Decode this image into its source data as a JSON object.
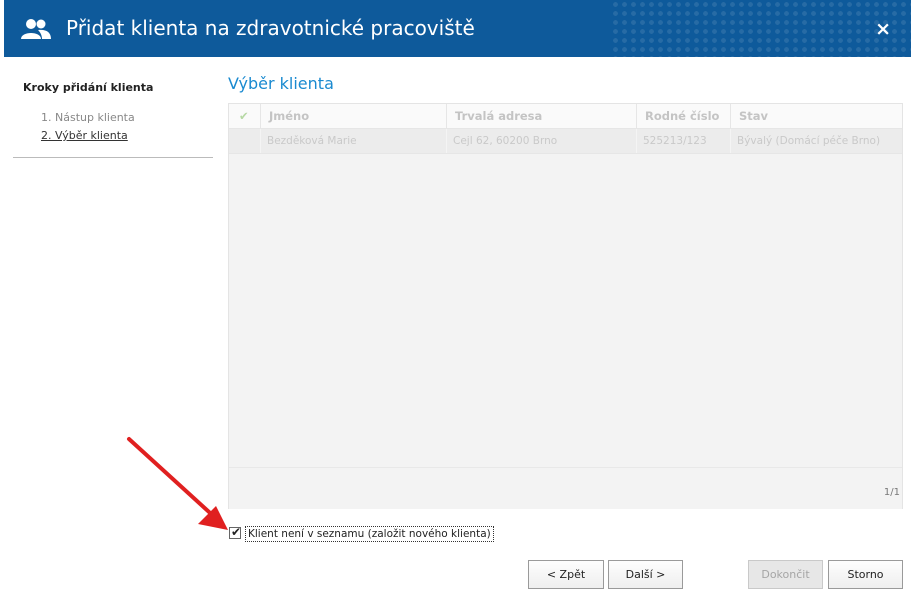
{
  "dialog": {
    "title": "Přidat klienta na zdravotnické pracoviště",
    "close_label": "×"
  },
  "steps": {
    "title": "Kroky přidání klienta",
    "items": [
      {
        "label": "1. Nástup klienta",
        "active": false
      },
      {
        "label": "2. Výběr klienta",
        "active": true
      }
    ]
  },
  "main": {
    "section_title": "Výběr klienta",
    "table": {
      "columns": [
        "✔",
        "Jméno",
        "Trvalá adresa",
        "Rodné číslo",
        "Stav"
      ],
      "rows": [
        {
          "check": "",
          "name": "Bezděková Marie",
          "address": "Cejl 62, 60200 Brno",
          "birth_number": "525213/123",
          "status": "Bývalý (Domácí péče Brno)"
        }
      ],
      "page_info": "1/1"
    },
    "new_client_checkbox": {
      "checked": true,
      "label": "Klient není v seznamu (založit nového klienta)"
    }
  },
  "buttons": {
    "back": "< Zpět",
    "next": "Další >",
    "finish": "Dokončit",
    "cancel": "Storno"
  },
  "colors": {
    "titlebar": "#0e5a9b",
    "section_title": "#1a8ad0",
    "arrow": "#e02020"
  },
  "icons": {
    "title": "users-icon",
    "close": "close-icon",
    "check": "checkmark-icon"
  }
}
